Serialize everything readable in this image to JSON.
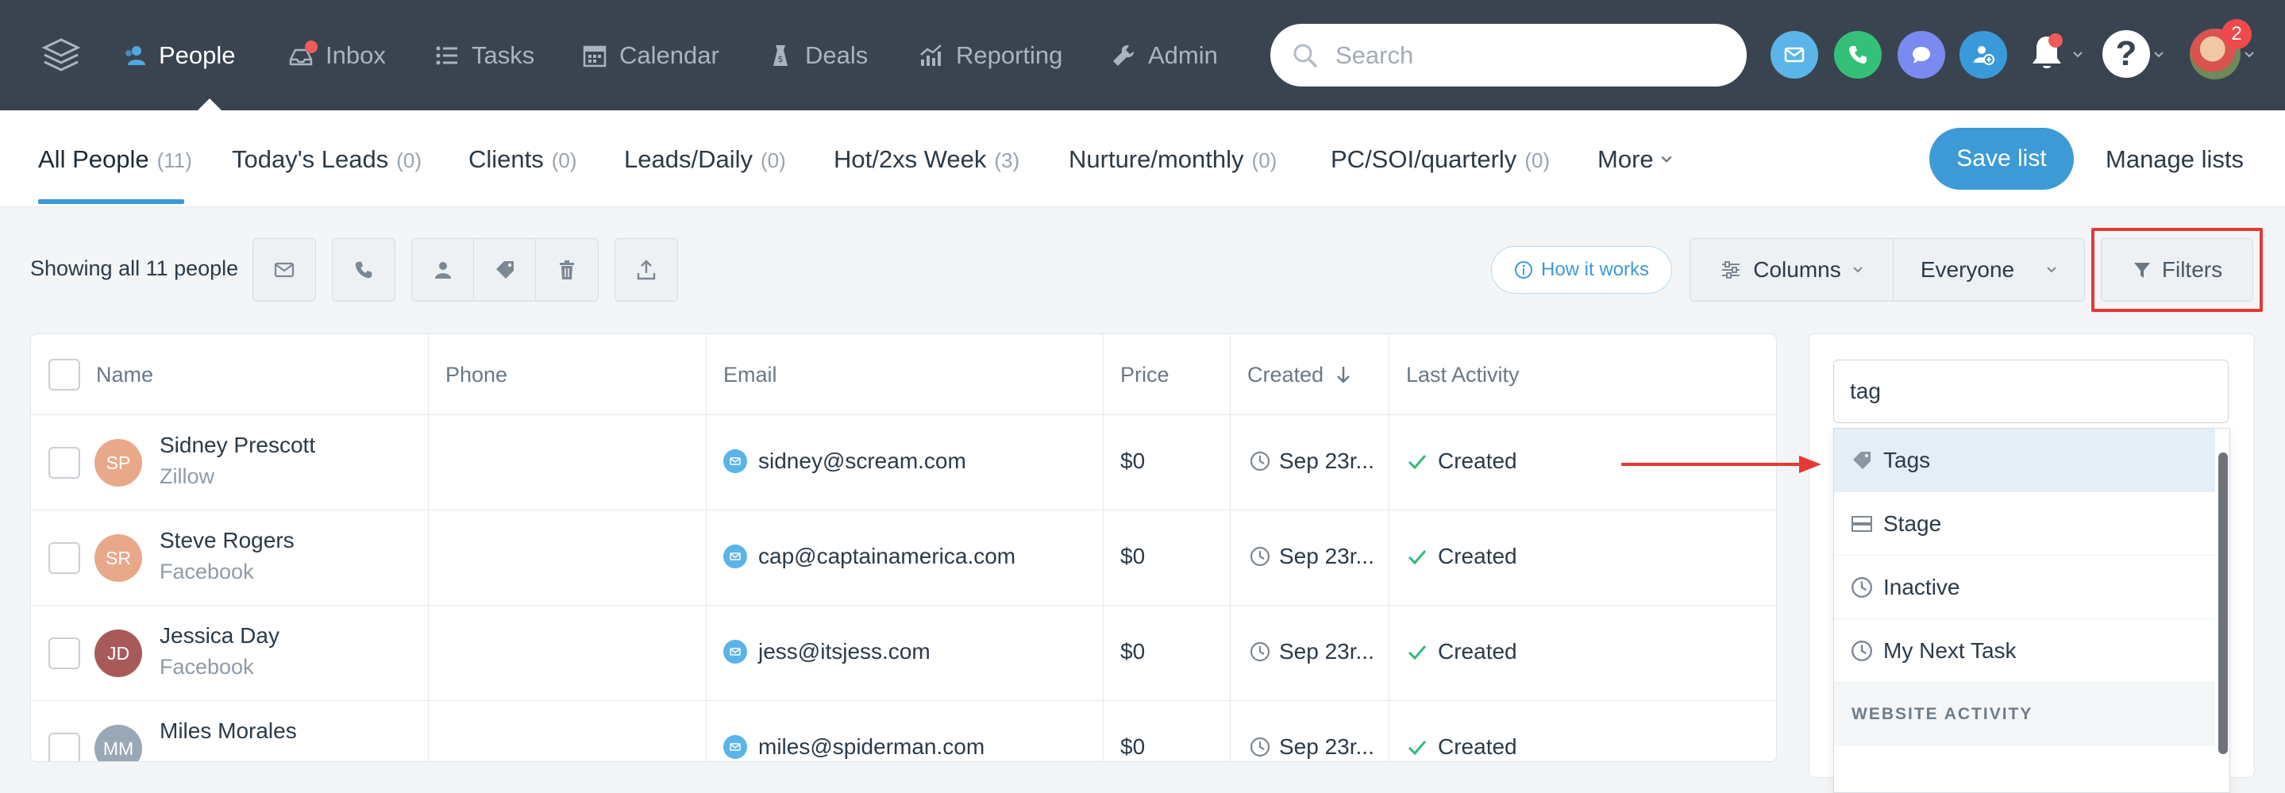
{
  "nav": {
    "items": [
      {
        "label": "People",
        "icon": "people-icon"
      },
      {
        "label": "Inbox",
        "icon": "inbox-icon"
      },
      {
        "label": "Tasks",
        "icon": "tasks-icon"
      },
      {
        "label": "Calendar",
        "icon": "calendar-icon"
      },
      {
        "label": "Deals",
        "icon": "deals-icon"
      },
      {
        "label": "Reporting",
        "icon": "reporting-icon"
      },
      {
        "label": "Admin",
        "icon": "admin-icon"
      }
    ],
    "search_placeholder": "Search",
    "notification_count": "2",
    "help_glyph": "?",
    "colors": {
      "bar": "#3a4450",
      "email": "#5bb5e8",
      "phone": "#35c07a",
      "chat": "#7b8af0",
      "add_contact": "#3a9ad9"
    }
  },
  "lists": {
    "tabs": [
      {
        "label": "All People",
        "count": "(11)"
      },
      {
        "label": "Today's Leads",
        "count": "(0)"
      },
      {
        "label": "Clients",
        "count": "(0)"
      },
      {
        "label": "Leads/Daily",
        "count": "(0)"
      },
      {
        "label": "Hot/2xs Week",
        "count": "(3)"
      },
      {
        "label": "Nurture/monthly",
        "count": "(0)"
      },
      {
        "label": "PC/SOI/quarterly",
        "count": "(0)"
      }
    ],
    "more_label": "More",
    "save_label": "Save list",
    "manage_label": "Manage lists",
    "accent": "#3d9ad6"
  },
  "toolbar": {
    "showing": "Showing all 11 people",
    "how_it_works": "How it works",
    "columns_label": "Columns",
    "everyone_label": "Everyone",
    "filters_label": "Filters"
  },
  "table": {
    "headers": {
      "name": "Name",
      "phone": "Phone",
      "email": "Email",
      "price": "Price",
      "created": "Created",
      "last_activity": "Last Activity"
    },
    "rows": [
      {
        "initials": "SP",
        "name": "Sidney Prescott",
        "source": "Zillow",
        "email": "sidney@scream.com",
        "price": "$0",
        "created": "Sep 23r...",
        "activity": "Created",
        "avatar_color": "#e8a98a"
      },
      {
        "initials": "SR",
        "name": "Steve Rogers",
        "source": "Facebook",
        "email": "cap@captainamerica.com",
        "price": "$0",
        "created": "Sep 23r...",
        "activity": "Created",
        "avatar_color": "#e8a98a"
      },
      {
        "initials": "JD",
        "name": "Jessica Day",
        "source": "Facebook",
        "email": "jess@itsjess.com",
        "price": "$0",
        "created": "Sep 23r...",
        "activity": "Created",
        "avatar_color": "#a85a5a"
      },
      {
        "initials": "MM",
        "name": "Miles Morales",
        "source": "",
        "email": "miles@spiderman.com",
        "price": "$0",
        "created": "Sep 23r...",
        "activity": "Created",
        "avatar_color": "#9aa8b6"
      }
    ]
  },
  "filter_panel": {
    "query": "tag",
    "options": [
      {
        "label": "Tags",
        "icon": "tag-icon"
      },
      {
        "label": "Stage",
        "icon": "stage-icon"
      },
      {
        "label": "Inactive",
        "icon": "clock-icon"
      },
      {
        "label": "My Next Task",
        "icon": "clock-icon"
      }
    ],
    "section_heading": "WEBSITE ACTIVITY"
  }
}
